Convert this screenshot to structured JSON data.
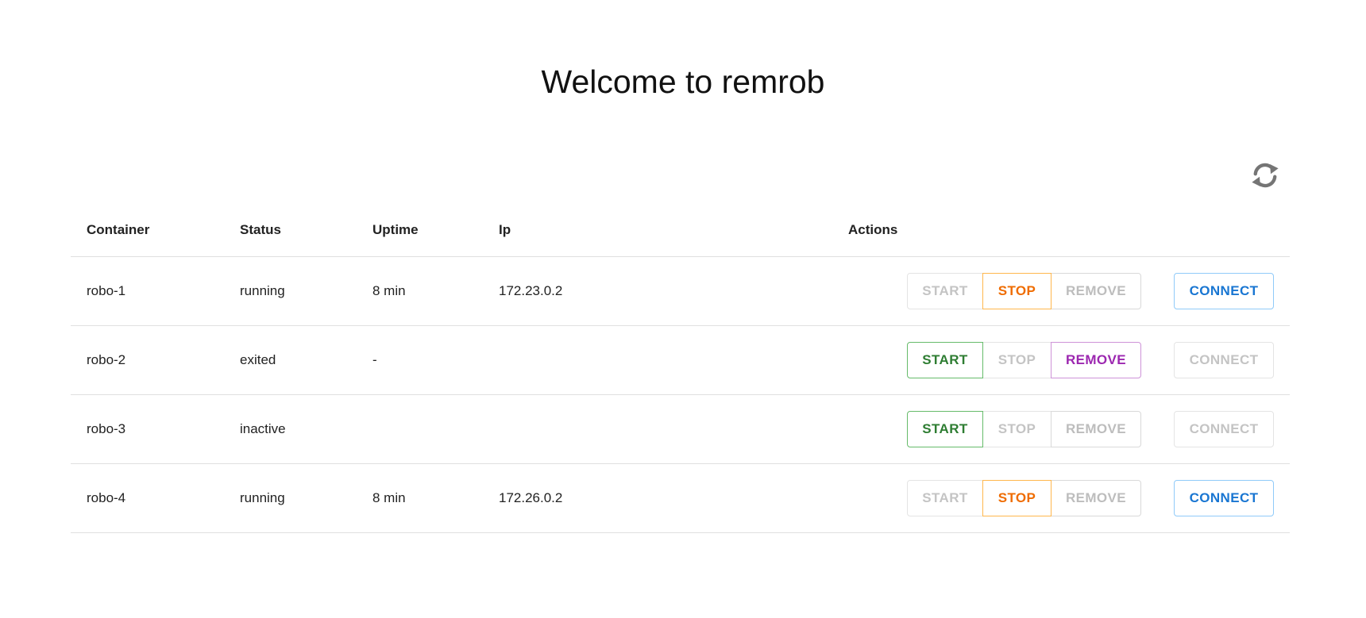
{
  "header": {
    "title": "Welcome to remrob"
  },
  "toolbar": {
    "refresh_icon": "refresh-icon"
  },
  "table": {
    "columns": [
      "Container",
      "Status",
      "Uptime",
      "Ip",
      "Actions"
    ],
    "rows": [
      {
        "container": "robo-1",
        "status": "running",
        "uptime": "8 min",
        "ip": "172.23.0.2"
      },
      {
        "container": "robo-2",
        "status": "exited",
        "uptime": "-",
        "ip": ""
      },
      {
        "container": "robo-3",
        "status": "inactive",
        "uptime": "",
        "ip": ""
      },
      {
        "container": "robo-4",
        "status": "running",
        "uptime": "8 min",
        "ip": "172.26.0.2"
      }
    ]
  },
  "actions": {
    "start_label": "START",
    "stop_label": "STOP",
    "remove_label": "REMOVE",
    "connect_label": "CONNECT"
  },
  "colors": {
    "running": "#2e7d32",
    "exited": "#e53935",
    "start": "#2e7d32",
    "stop": "#ef6c00",
    "remove": "#9c27b0",
    "connect": "#1976d2"
  }
}
